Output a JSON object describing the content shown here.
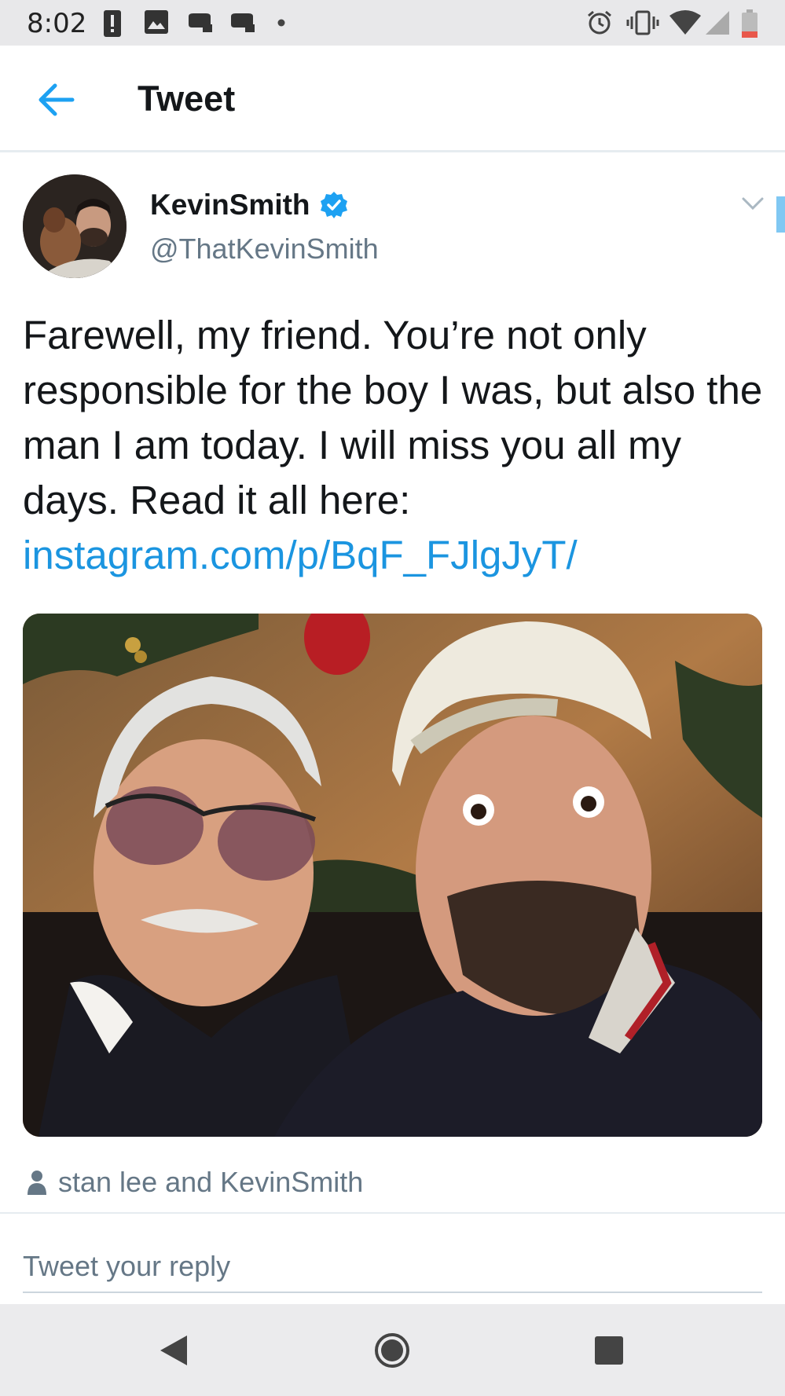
{
  "status_bar": {
    "time": "8:02",
    "left_icons": [
      "alert-icon",
      "image-icon",
      "gamepad-icon",
      "gamepad-icon",
      "dot-icon"
    ],
    "right_icons": [
      "alarm-icon",
      "vibrate-icon",
      "wifi-icon",
      "signal-icon",
      "battery-icon"
    ]
  },
  "app_bar": {
    "title": "Tweet",
    "back_icon": "back-arrow-icon"
  },
  "tweet": {
    "display_name": "KevinSmith",
    "verified": true,
    "handle": "@ThatKevinSmith",
    "text": "Farewell, my friend. You’re not only responsible for the boy I was, but also the man I am today. I will miss you all my days. Read it all here:",
    "link_text": "instagram.com/p/BqF_FJlgJyT/",
    "tagged": "stan lee and KevinSmith"
  },
  "reply": {
    "placeholder": "Tweet your reply"
  },
  "nav_bar": {
    "icons": [
      "back-triangle-icon",
      "home-circle-icon",
      "recents-square-icon"
    ]
  },
  "colors": {
    "accent": "#1b95e0",
    "text": "#14171a",
    "secondary": "#657786",
    "verified": "#1da1f2"
  }
}
